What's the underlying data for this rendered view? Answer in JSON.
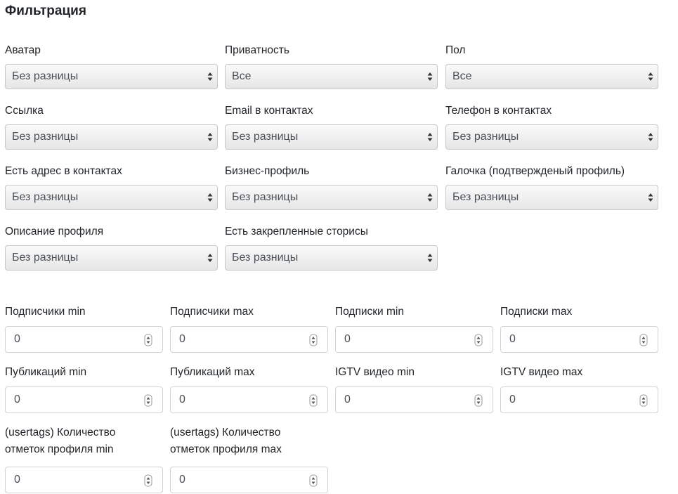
{
  "title": "Фильтрация",
  "selects": [
    {
      "label": "Аватар",
      "value": "Без разницы"
    },
    {
      "label": "Приватность",
      "value": "Все"
    },
    {
      "label": "Пол",
      "value": "Все"
    },
    {
      "label": "Ссылка",
      "value": "Без разницы"
    },
    {
      "label": "Email в контактах",
      "value": "Без разницы"
    },
    {
      "label": "Телефон в контактах",
      "value": "Без разницы"
    },
    {
      "label": "Есть адрес в контактах",
      "value": "Без разницы"
    },
    {
      "label": "Бизнес-профиль",
      "value": "Без разницы"
    },
    {
      "label": "Галочка (подтвержденый профиль)",
      "value": "Без разницы"
    },
    {
      "label": "Описание профиля",
      "value": "Без разницы"
    },
    {
      "label": "Есть закрепленные сторисы",
      "value": "Без разницы"
    }
  ],
  "numbers": [
    {
      "label": "Подписчики min",
      "value": "0"
    },
    {
      "label": "Подписчики max",
      "value": "0"
    },
    {
      "label": "Подписки min",
      "value": "0"
    },
    {
      "label": "Подписки max",
      "value": "0"
    },
    {
      "label": "Публикаций min",
      "value": "0"
    },
    {
      "label": "Публикаций max",
      "value": "0"
    },
    {
      "label": "IGTV видео min",
      "value": "0"
    },
    {
      "label": "IGTV видео max",
      "value": "0"
    },
    {
      "label": "(usertags) Количество отметок профиля min",
      "value": "0"
    },
    {
      "label": "(usertags) Количество отметок профиля max",
      "value": "0"
    }
  ],
  "icons": {
    "select_arrow": "chevron-up-down-icon",
    "number_spinner": "spinner-arrows-icon"
  }
}
